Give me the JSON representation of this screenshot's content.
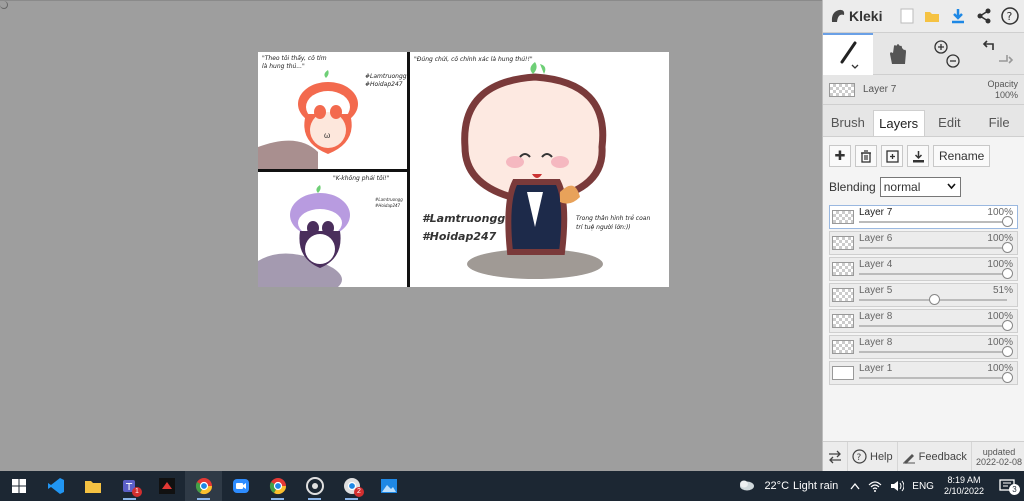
{
  "app": {
    "name": "Kleki"
  },
  "tools": {
    "brush_icon": "brush-icon",
    "hand_icon": "hand-icon",
    "zoom_in_icon": "zoom-in-icon",
    "zoom_out_icon": "zoom-out-icon",
    "undo_icon": "undo-icon",
    "redo_icon": "redo-icon"
  },
  "current_layer": {
    "name": "Layer 7",
    "opacity_label": "Opacity",
    "opacity_value": "100%"
  },
  "tabs": [
    {
      "label": "Brush"
    },
    {
      "label": "Layers"
    },
    {
      "label": "Edit"
    },
    {
      "label": "File"
    }
  ],
  "layers_panel": {
    "rename_label": "Rename",
    "blending_label": "Blending",
    "blending_value": "normal"
  },
  "layers": [
    {
      "name": "Layer 7",
      "opacity": "100%",
      "level": 1.0
    },
    {
      "name": "Layer 6",
      "opacity": "100%",
      "level": 1.0
    },
    {
      "name": "Layer 4",
      "opacity": "100%",
      "level": 1.0
    },
    {
      "name": "Layer 5",
      "opacity": "51%",
      "level": 0.51
    },
    {
      "name": "Layer 8",
      "opacity": "100%",
      "level": 1.0
    },
    {
      "name": "Layer 8",
      "opacity": "100%",
      "level": 1.0
    },
    {
      "name": "Layer 1",
      "opacity": "100%",
      "level": 1.0
    }
  ],
  "sidebar_bottom": {
    "help_label": "Help",
    "feedback_label": "Feedback",
    "updated_label": "updated",
    "updated_date": "2022-02-08"
  },
  "artwork": {
    "panel1_text": "\"Theo tôi thấy, cô tím\nlà hung thủ...\"",
    "panel1_tag1": "#Lamtruongg",
    "panel1_tag2": "#Hoidap247",
    "panel2_text": "\"K-không phải tôi!\"",
    "panel2_tag1": "#Lamtruongg",
    "panel2_tag2": "#Hoidap247",
    "panel3_text": "\"Đúng chứi, cô chính xác là hung thủ!!\"",
    "panel3_tag1": "#Lamtruongg",
    "panel3_tag2": "#Hoidap247",
    "panel3_caption": "Trong thân hình trẻ coan\ntrí tuệ người lớn:))"
  },
  "taskbar": {
    "weather_temp": "22°C",
    "weather_desc": "Light rain",
    "language": "ENG",
    "time": "8:19 AM",
    "date": "2/10/2022",
    "teams_badge": "1",
    "chrome_badge": "2",
    "notification_count": "3"
  }
}
